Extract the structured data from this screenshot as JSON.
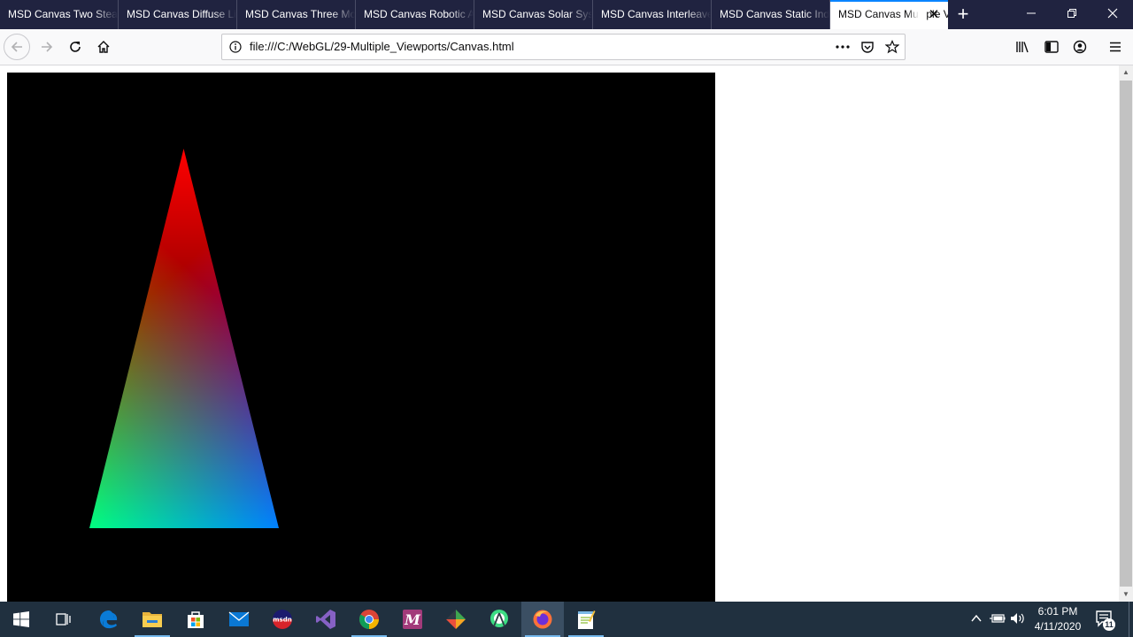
{
  "browser": {
    "tabs": [
      {
        "label": "MSD Canvas Two Steady"
      },
      {
        "label": "MSD Canvas Diffuse Light"
      },
      {
        "label": "MSD Canvas Three Models"
      },
      {
        "label": "MSD Canvas Robotic Arm"
      },
      {
        "label": "MSD Canvas Solar System"
      },
      {
        "label": "MSD Canvas Interleaved"
      },
      {
        "label": "MSD Canvas Static Index"
      },
      {
        "label": "MSD Canvas Multiple Viewports"
      }
    ],
    "url": "file:///C:/WebGL/29-Multiple_Viewports/Canvas.html"
  },
  "canvas": {
    "background": "#000000",
    "triangle_colors": {
      "top": "#ff0000",
      "bottom_left": "#00ff00",
      "bottom_right": "#0000ff"
    }
  },
  "taskbar": {
    "time": "6:01 PM",
    "date": "4/11/2020",
    "notification_count": "11",
    "apps": [
      "start-icon",
      "task-view-icon",
      "edge-icon",
      "file-explorer-icon",
      "store-icon",
      "mail-icon",
      "msdn-icon",
      "visual-studio-icon",
      "chrome-icon",
      "mathcad-icon",
      "git-icon",
      "android-studio-icon",
      "firefox-icon",
      "notepad-icon"
    ]
  }
}
